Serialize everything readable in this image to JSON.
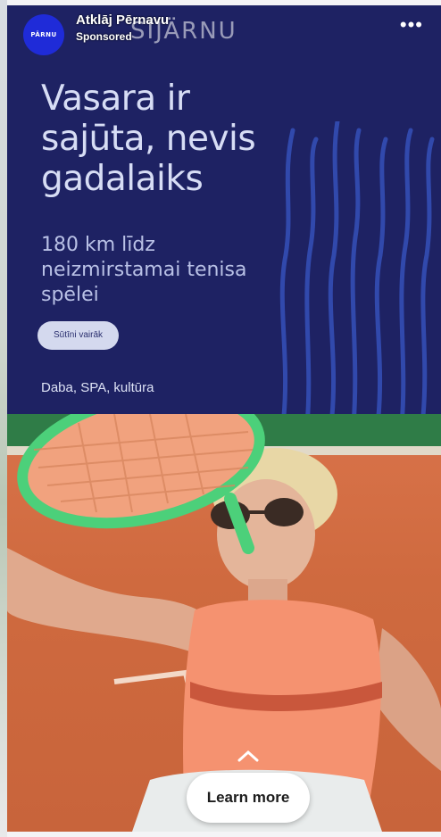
{
  "header": {
    "page_name": "Atklāj Pērnavu",
    "sponsored_label": "Sponsored",
    "avatar_text": "PÄRNU",
    "ghost_logo_text": "SIJÄRNU",
    "more_icon": "more-horizontal-icon"
  },
  "ad": {
    "headline": "Vasara ir sajūta, nevis gadalaiks",
    "subhead": "180 km līdz neizmirstamai tenisa spēlei",
    "button_label": "Sūtīni vairāk",
    "tags": "Daba, SPA, kultūra"
  },
  "cta": {
    "label": "Learn more",
    "chevron_icon": "chevron-up-icon"
  },
  "colors": {
    "background_navy": "#1e2263",
    "accent_blue": "#2f4bb8",
    "court_orange": "#cf6a3f"
  }
}
